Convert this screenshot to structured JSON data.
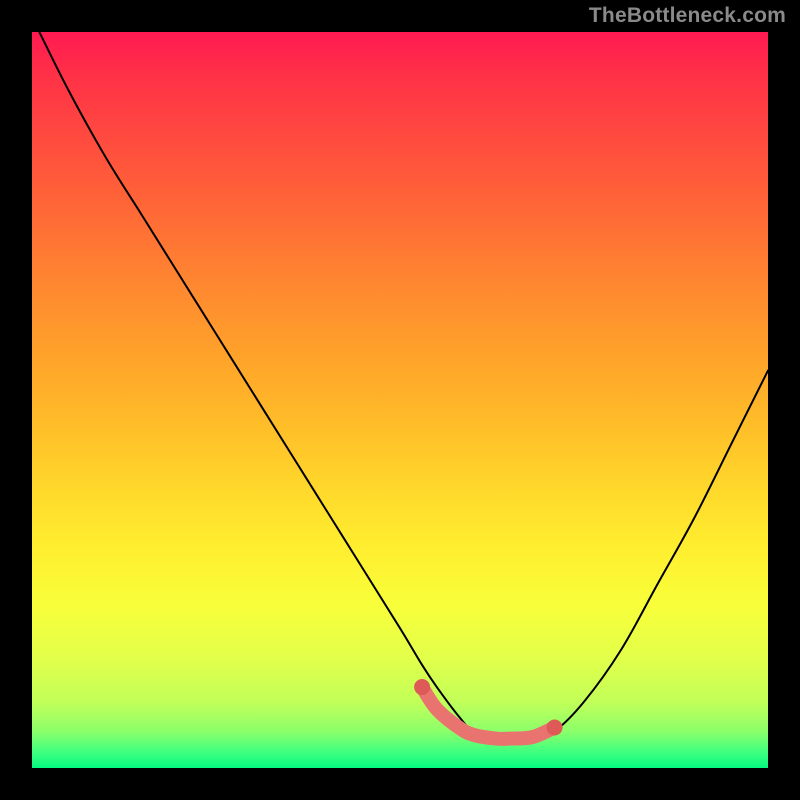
{
  "watermark": "TheBottleneck.com",
  "colors": {
    "background": "#000000",
    "curve": "#000000",
    "marker": "#e9746f",
    "marker_dark": "#cf5551"
  },
  "chart_data": {
    "type": "line",
    "title": "",
    "xlabel": "",
    "ylabel": "",
    "xlim": [
      0,
      100
    ],
    "ylim": [
      0,
      100
    ],
    "annotations": [
      "TheBottleneck.com"
    ],
    "series": [
      {
        "name": "bottleneck-curve",
        "x": [
          1,
          5,
          10,
          15,
          20,
          25,
          30,
          35,
          40,
          45,
          50,
          53,
          55,
          58,
          60,
          63,
          65,
          68,
          71,
          75,
          80,
          85,
          90,
          95,
          100
        ],
        "values": [
          100,
          92,
          83,
          75,
          67,
          59,
          51,
          43,
          35,
          27,
          19,
          14,
          11,
          7,
          5,
          4,
          4,
          4,
          5,
          9,
          16,
          25,
          34,
          44,
          54
        ]
      }
    ],
    "highlight": {
      "name": "optimal-range",
      "x": [
        53,
        55,
        58,
        60,
        63,
        65,
        68,
        71
      ],
      "values": [
        11,
        8,
        5.5,
        4.5,
        4,
        4,
        4.2,
        5.5
      ]
    }
  }
}
